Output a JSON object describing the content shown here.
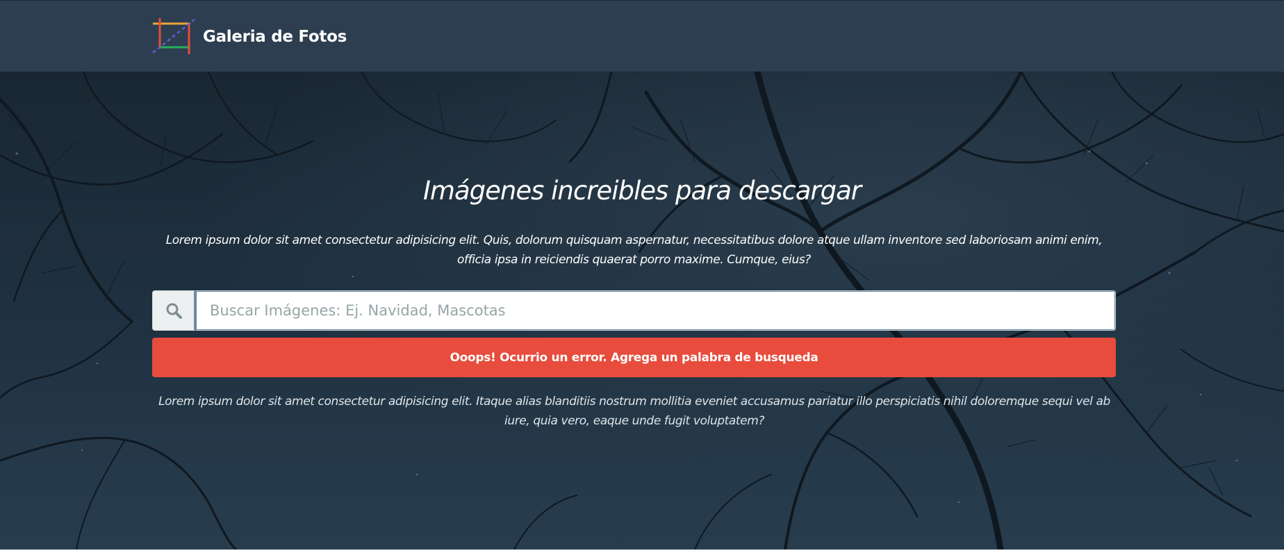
{
  "navbar": {
    "brand_name": "Galeria de Fotos",
    "logo_icon": "crop-frame-logo-icon"
  },
  "hero": {
    "title": "Imágenes increibles para descargar",
    "description": "Lorem ipsum dolor sit amet consectetur adipisicing elit. Quis, dolorum quisquam aspernatur, necessitatibus dolore atque ullam inventore sed laboriosam animi enim, officia ipsa in reiciendis quaerat porro maxime. Cumque, eius?",
    "footnote": "Lorem ipsum dolor sit amet consectetur adipisicing elit. Itaque alias blanditiis nostrum mollitia eveniet accusamus pariatur illo perspiciatis nihil doloremque sequi vel ab iure, quia vero, eaque unde fugit voluptatem?"
  },
  "search": {
    "icon": "search-icon",
    "placeholder": "Buscar Imágenes: Ej. Navidad, Mascotas",
    "value": ""
  },
  "alert": {
    "message": "Ooops! Ocurrio un error. Agrega un palabra de busqueda"
  },
  "colors": {
    "navbar_bg": "#2c3e50",
    "alert_bg": "#e74c3c",
    "addon_bg": "#ecf0f1",
    "placeholder": "#95a5a6"
  }
}
